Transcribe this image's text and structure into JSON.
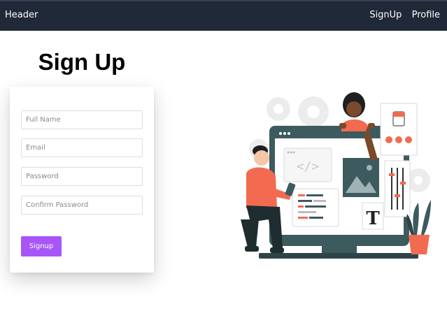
{
  "header": {
    "brand": "Header",
    "nav": [
      {
        "label": "SignUp"
      },
      {
        "label": "Profile"
      }
    ]
  },
  "page": {
    "title": "Sign Up"
  },
  "form": {
    "fields": [
      {
        "placeholder": "Full Name",
        "value": ""
      },
      {
        "placeholder": "Email",
        "value": ""
      },
      {
        "placeholder": "Password",
        "value": ""
      },
      {
        "placeholder": "Confirm Password",
        "value": ""
      }
    ],
    "submit_label": "Signup"
  },
  "illustration": {
    "code_icon": "</>",
    "text_icon": "T"
  },
  "colors": {
    "navbar": "#1f2937",
    "button": "#a855f7",
    "accent": "#f26b50",
    "screen": "#3d5a5e"
  }
}
